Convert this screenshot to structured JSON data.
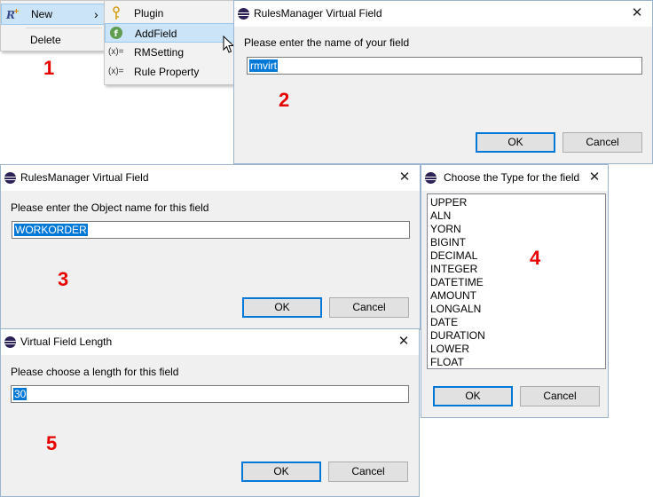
{
  "menu1": {
    "new_label": "New",
    "delete_label": "Delete",
    "new_icon": "rules-plugin-icon",
    "submenu_arrow": "›"
  },
  "submenu": {
    "items": [
      {
        "label": "Plugin",
        "icon": "key-icon"
      },
      {
        "label": "AddField",
        "icon": "green-f-icon"
      },
      {
        "label": "RMSetting",
        "icon": "variable-icon",
        "icon_text": "(x)="
      },
      {
        "label": "Rule Property",
        "icon": "variable-icon",
        "icon_text": "(x)="
      }
    ]
  },
  "dialog2": {
    "title": "RulesManager Virtual Field",
    "prompt": "Please enter the name of your field",
    "value": "rmvirt",
    "ok": "OK",
    "cancel": "Cancel"
  },
  "dialog3": {
    "title": "RulesManager Virtual Field",
    "prompt": "Please enter the Object name for this field",
    "value": "WORKORDER",
    "ok": "OK",
    "cancel": "Cancel"
  },
  "dialog4": {
    "title": "Choose the Type for the field",
    "types": [
      "UPPER",
      "ALN",
      "YORN",
      "BIGINT",
      "DECIMAL",
      "INTEGER",
      "DATETIME",
      "AMOUNT",
      "LONGALN",
      "DATE",
      "DURATION",
      "LOWER",
      "FLOAT"
    ],
    "ok": "OK",
    "cancel": "Cancel"
  },
  "dialog5": {
    "title": "Virtual Field Length",
    "prompt": "Please choose a length for this field",
    "value": "30",
    "ok": "OK",
    "cancel": "Cancel"
  },
  "step_numbers": [
    "1",
    "2",
    "3",
    "4",
    "5"
  ],
  "close_glyph": "✕",
  "colors": {
    "step_number": "#e60000",
    "selection": "#0078d7",
    "menu_highlight": "#cce4f7",
    "default_button_border": "#0078d7"
  }
}
